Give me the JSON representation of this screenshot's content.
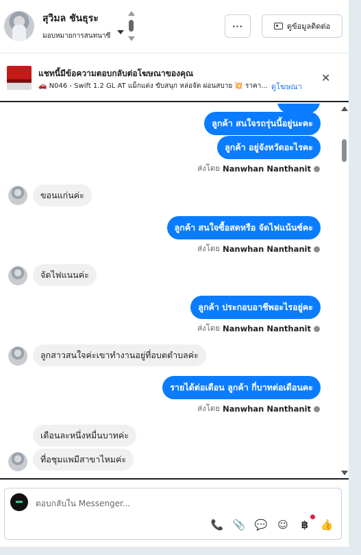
{
  "header": {
    "name": "สุวิมล ชันธุระ",
    "subtitle": "มอบหมายการสนทนาซี",
    "more_label": "···",
    "profile_label": "ดูข้อมูลติดต่อ"
  },
  "ad": {
    "title": "แชทนี้มีข้อความตอบกลับต่อโฆษณาของคุณ",
    "text": "🚗 N046 - Swift 1.2 GL AT แม็กแต่ง ขับสนุก หล่อจัด ผ่อนสบาย 💥 ราคา...",
    "link": "ดูโฆษณา",
    "close": "✕"
  },
  "messages": [
    {
      "dir": "out",
      "text": "ลูกค้า สนใจรถรุ่นนี้อยู่นะคะ"
    },
    {
      "dir": "out",
      "text": "ลูกค้า อยู่จังหวัดอะไรคะ"
    },
    {
      "dir": "sent",
      "prefix": "ส่งโดย",
      "name": "Nanwhan Nanthanit"
    },
    {
      "dir": "in",
      "text": "ขอนแก่นค่ะ"
    },
    {
      "dir": "out",
      "text": "ลูกค้า สนใจซื้อสดหรือ จัดไฟแน้นซ์คะ"
    },
    {
      "dir": "sent",
      "prefix": "ส่งโดย",
      "name": "Nanwhan Nanthanit"
    },
    {
      "dir": "in",
      "text": "จัดไฟแนนค่ะ"
    },
    {
      "dir": "out",
      "text": "ลูกค้า ประกอบอาชีพอะไรอยู่คะ"
    },
    {
      "dir": "sent",
      "prefix": "ส่งโดย",
      "name": "Nanwhan Nanthanit"
    },
    {
      "dir": "in",
      "text": "ลูกสาวสนใจค่ะเขาทำงานอยู่ที่อบตตำบลค่ะ"
    },
    {
      "dir": "out",
      "text": "รายได้ต่อเดือน ลูกค้า กี่บาทต่อเดือนคะ"
    },
    {
      "dir": "sent",
      "prefix": "ส่งโดย",
      "name": "Nanwhan Nanthanit"
    },
    {
      "dir": "in",
      "text": "เดือนละหนึ่งหมื่นบาทค่ะ"
    },
    {
      "dir": "in",
      "text": "ที่อชุมแพมีสาขาไหมค่ะ"
    }
  ],
  "composer": {
    "placeholder": "ตอบกลับใน Messenger..."
  },
  "icons": {
    "call": "📞",
    "attach": "📎",
    "chat": "💬",
    "emoji": "☺",
    "baht": "฿",
    "like": "👍"
  }
}
